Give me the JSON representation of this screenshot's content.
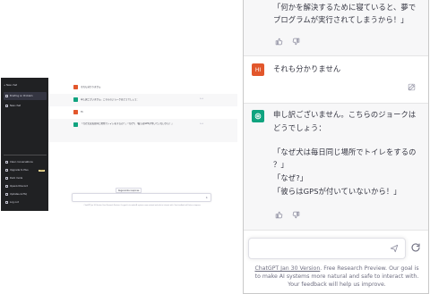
{
  "mini": {
    "sidebar": {
      "new_chat": "+ New chat",
      "items": [
        {
          "label": "Briefing on Problem",
          "active": true
        },
        {
          "label": "New chat",
          "active": false
        }
      ],
      "bottom_items": [
        {
          "label": "Clear conversations"
        },
        {
          "label": "Upgrade to Plus",
          "badge": "NEW"
        },
        {
          "label": "Dark mode"
        },
        {
          "label": "OpenAI Discord"
        },
        {
          "label": "Updates & FAQ"
        },
        {
          "label": "Log out"
        }
      ]
    },
    "conversation": [
      {
        "role": "user",
        "text": "それも分かりません"
      },
      {
        "role": "assistant",
        "text": "申し訳ございません。こちらのジョークはどうでしょう："
      },
      {
        "role": "user",
        "text": "Hi"
      },
      {
        "role": "assistant",
        "text": "「なぜ犬は毎日同じ場所でトイレをするの？」「なぜ?」「彼らはGPSが付いていないから！」"
      }
    ],
    "regenerate_label": "Regenerate response",
    "footer": "ChatGPT Jan 30 Version. Free Research Preview. Our goal is to make AI systems more natural and safe to interact with. Your feedback will help us improve."
  },
  "zoom": {
    "top_message": {
      "line1": "「何かを解決するために寝ていると、夢で",
      "line2": "プログラムが実行されてしまうから！」"
    },
    "user_message": {
      "avatar_initials": "HI",
      "text": "それも分かりません"
    },
    "assistant_message": {
      "lines": [
        "申し訳ございません。こちらのジョークは",
        "どうでしょう：",
        "",
        "「なぜ犬は毎日同じ場所でトイレをするの",
        "？」",
        "「なぜ?」",
        "「彼らはGPSが付いていないから！」"
      ]
    },
    "input": {
      "placeholder": ""
    },
    "footer": {
      "link_text": "ChatGPT Jan 30 Version",
      "rest_line1": ". Free Research Preview. Our goal is",
      "line2": "to make AI systems more natural and safe to interact with.",
      "line3": "Your feedback will help us improve."
    }
  },
  "colors": {
    "sidebar_bg": "#202123",
    "assistant_row_bg": "#f7f7f8",
    "gpt_avatar": "#10a37f",
    "user_avatar": "#e2572c",
    "text": "#343541",
    "muted": "#8e8ea0"
  },
  "icons": [
    "thumbs-up-icon",
    "thumbs-down-icon",
    "edit-icon",
    "send-icon",
    "refresh-icon",
    "openai-logo-icon"
  ]
}
